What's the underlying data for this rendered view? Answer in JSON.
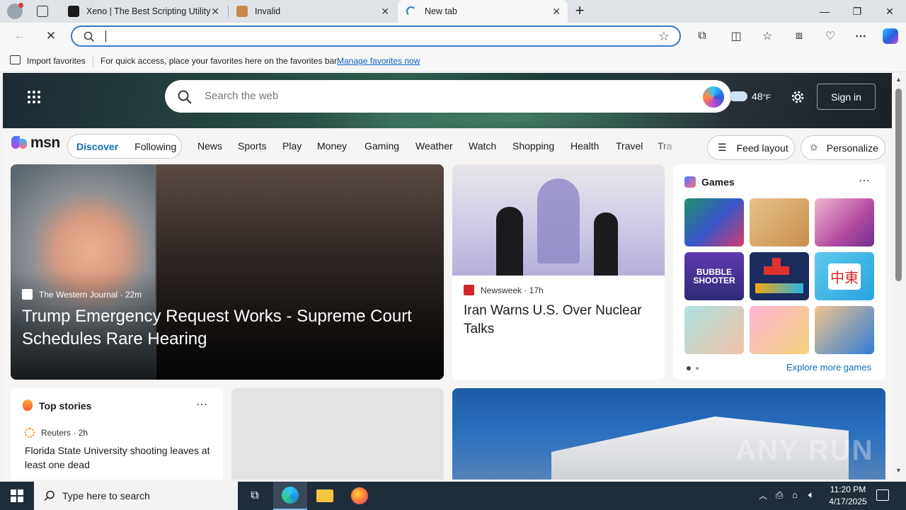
{
  "tabs": [
    {
      "title": "Xeno | The Best Scripting Utility",
      "favicon_color": "#1b1b1b"
    },
    {
      "title": "Invalid",
      "favicon_color": "#c98a4a"
    },
    {
      "title": "New tab",
      "favicon_color": "#2b7bd1"
    }
  ],
  "address_bar": {
    "value": "",
    "placeholder": ""
  },
  "favorites_bar": {
    "import_label": "Import favorites",
    "hint": "For quick access, place your favorites here on the favorites bar.",
    "manage_link": "Manage favorites now"
  },
  "msn": {
    "search_placeholder": "Search the web",
    "weather_temp": "48",
    "weather_unit": "°F",
    "sign_in": "Sign in",
    "logo": "msn",
    "tabs": [
      "Discover",
      "Following"
    ],
    "categories": [
      "News",
      "Sports",
      "Play",
      "Money",
      "Gaming",
      "Weather",
      "Watch",
      "Shopping",
      "Health",
      "Travel",
      "Tra"
    ],
    "feed_layout": "Feed layout",
    "personalize": "Personalize"
  },
  "hero_story": {
    "source": "The Western Journal",
    "age": "22m",
    "title": "Trump Emergency Request Works - Supreme Court Schedules Rare Hearing"
  },
  "second_story": {
    "source": "Newsweek",
    "age": "17h",
    "title": "Iran Warns U.S. Over Nuclear Talks"
  },
  "games": {
    "title": "Games",
    "explore": "Explore more games",
    "tiles": [
      "jewel-puzzle",
      "wood-screw",
      "makeup",
      "bubble-shooter",
      "block-puzzle",
      "mahjong",
      "hospital",
      "dress-up",
      "restaurant"
    ],
    "bubble_label": "BUBBLE SHOOTER",
    "mahjong_chars": "中東"
  },
  "top_stories": {
    "title": "Top stories",
    "source": "Reuters",
    "age": "2h",
    "headline": "Florida State University shooting leaves at least one dead"
  },
  "taskbar": {
    "search_placeholder": "Type here to search",
    "time": "11:20 PM",
    "date": "4/17/2025"
  },
  "watermark": "ANY RUN",
  "colors": {
    "accent": "#0f6cbd",
    "edge_blue": "#3b76c8",
    "taskbar": "#1f2c3a"
  }
}
